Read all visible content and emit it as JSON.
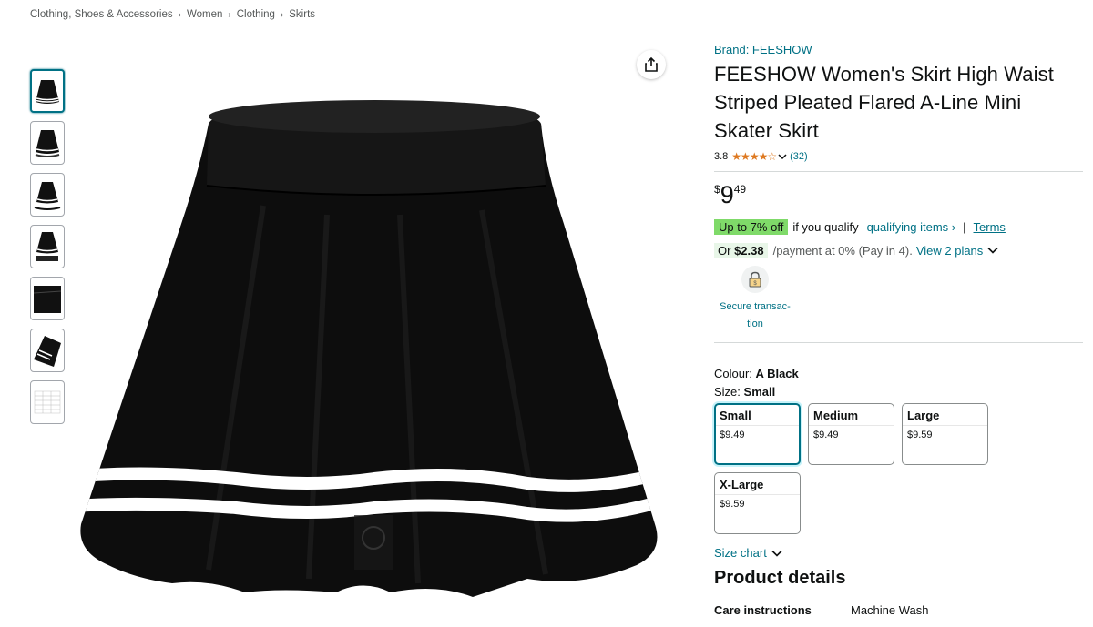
{
  "breadcrumb": [
    "Clothing, Shoes & Accessories",
    "Women",
    "Clothing",
    "Skirts"
  ],
  "icons": {
    "share": "share-icon",
    "secure": "lock-icon"
  },
  "colors": {
    "link": "#007185",
    "deal_badge": "#7fda69",
    "star": "#de7921"
  },
  "product": {
    "brand": "Brand: FEESHOW",
    "title": "FEESHOW Women's Skirt High Waist Striped Pleated Flared A-Line Mini Skater Skirt",
    "rating": "3.8",
    "rating_value": 3.8,
    "review_count": "(32)",
    "price": {
      "symbol": "$",
      "whole": "9",
      "fraction": "49"
    },
    "deal": {
      "badge": "Up to 7% off",
      "text": "if you qualify",
      "link": "qualifying items ›",
      "separator": "|",
      "terms": "Terms"
    },
    "payment": {
      "prefix": "Or",
      "amount": "$2.38",
      "text": "/payment at 0% (Pay in 4).",
      "link": "View 2 plans"
    },
    "secure_label": "Secure transac-tion",
    "colour": {
      "label": "Colour:",
      "value": "A Black"
    },
    "size": {
      "label": "Size:",
      "value": "Small",
      "options": [
        {
          "name": "Small",
          "price": "$9.49",
          "selected": true
        },
        {
          "name": "Medium",
          "price": "$9.49",
          "selected": false
        },
        {
          "name": "Large",
          "price": "$9.59",
          "selected": false
        },
        {
          "name": "X-Large",
          "price": "$9.59",
          "selected": false
        }
      ]
    },
    "size_chart": "Size chart",
    "details_title": "Product details",
    "details": [
      {
        "key": "Care instructions",
        "value": "Machine Wash"
      }
    ]
  },
  "thumbnails": 7,
  "active_thumbnail": 1
}
